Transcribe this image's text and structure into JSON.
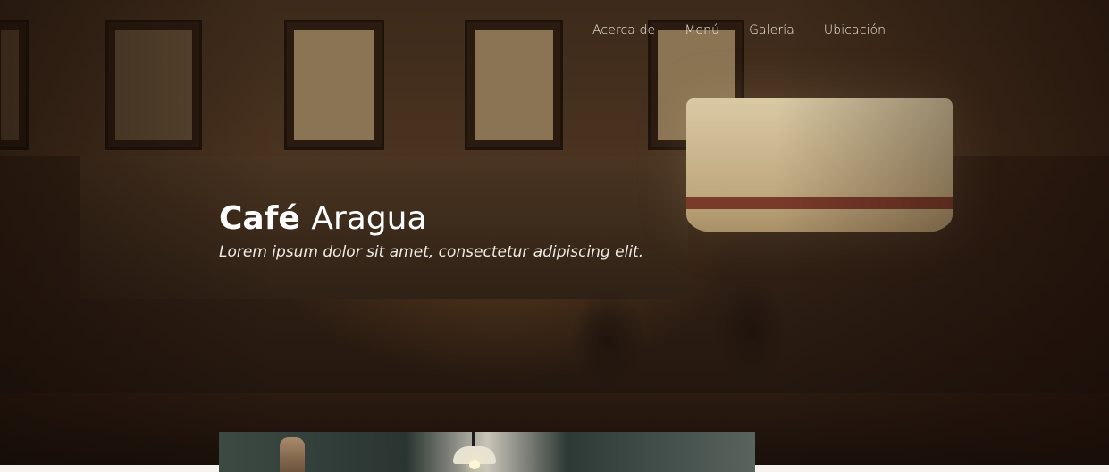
{
  "nav": {
    "items": [
      {
        "label": "Acerca de"
      },
      {
        "label": "Menú"
      },
      {
        "label": "Galería"
      },
      {
        "label": "Ubicación"
      }
    ]
  },
  "hero": {
    "title_bold": "Café",
    "title_light": "Aragua",
    "tagline": "Lorem ipsum dolor sit amet, consectetur adipiscing elit."
  },
  "colors": {
    "nav_text": "#f2ebe1",
    "hero_overlay": "#2a1a10",
    "page_background": "#f4f1ec"
  }
}
